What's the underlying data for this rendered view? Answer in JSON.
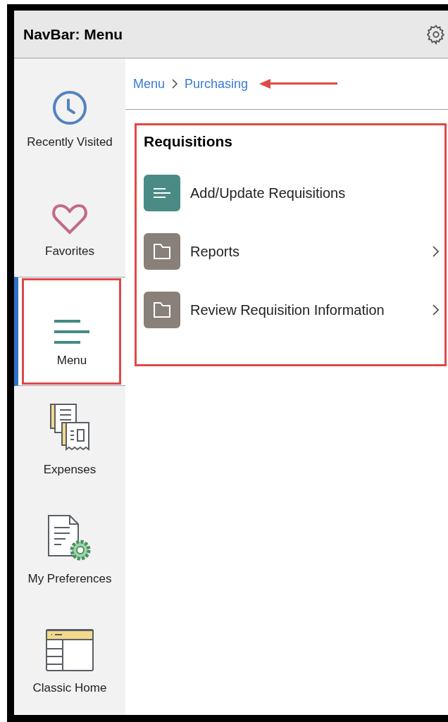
{
  "header": {
    "title": "NavBar: Menu"
  },
  "nav_items": [
    {
      "label": "Recently Visited",
      "kind": "clock",
      "selected": false,
      "highlighted": false
    },
    {
      "label": "Favorites",
      "kind": "heart",
      "selected": false,
      "highlighted": false
    },
    {
      "label": "Menu",
      "kind": "menu",
      "selected": true,
      "highlighted": true
    },
    {
      "label": "Expenses",
      "kind": "receipts",
      "selected": false,
      "highlighted": false
    },
    {
      "label": "My Preferences",
      "kind": "preferences",
      "selected": false,
      "highlighted": false
    },
    {
      "label": "Classic Home",
      "kind": "classic",
      "selected": false,
      "highlighted": false
    }
  ],
  "breadcrumb": {
    "items": [
      "Menu",
      "Purchasing"
    ],
    "arrow_annotation": true
  },
  "section": {
    "title": "Requisitions",
    "highlighted": true,
    "items": [
      {
        "label": "Add/Update Requisitions",
        "kind": "component",
        "has_children": false
      },
      {
        "label": "Reports",
        "kind": "folder",
        "has_children": true
      },
      {
        "label": "Review Requisition Information",
        "kind": "folder",
        "has_children": true
      }
    ]
  }
}
